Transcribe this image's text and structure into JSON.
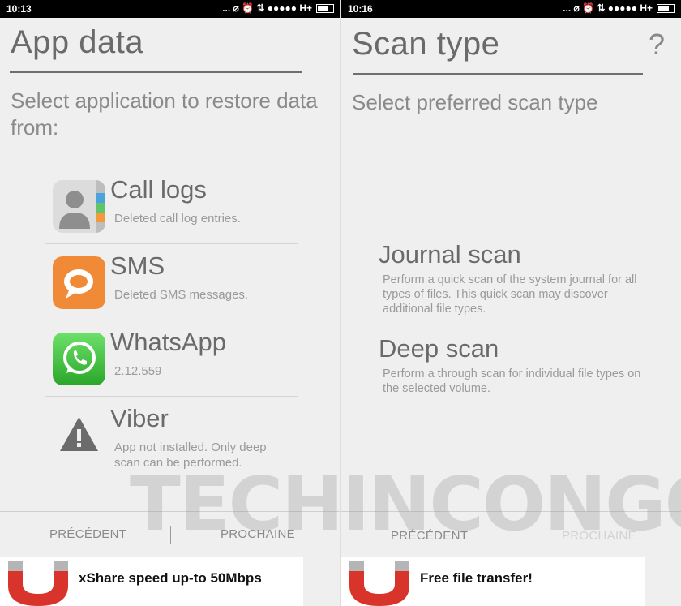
{
  "left": {
    "status_time": "10:13",
    "status_icons": "... ⌀ ⏰ ⇅ ●●●●● H+",
    "title": "App data",
    "subtitle": "Select application to restore data from:",
    "apps": [
      {
        "name": "Call logs",
        "desc": "Deleted call log entries.",
        "icon": "contacts-icon"
      },
      {
        "name": "SMS",
        "desc": "Deleted SMS messages.",
        "icon": "sms-icon"
      },
      {
        "name": "WhatsApp",
        "desc": "2.12.559",
        "icon": "whatsapp-icon"
      },
      {
        "name": "Viber",
        "desc": "App not installed. Only deep scan can be performed.",
        "icon": "warning-icon"
      }
    ],
    "prev_label": "PRÉCÉDENT",
    "next_label": "PROCHAINE",
    "ad_text": "xShare speed up-to 50Mbps"
  },
  "right": {
    "status_time": "10:16",
    "status_icons": "... ⌀ ⏰ ⇅ ●●●●● H+",
    "title": "Scan type",
    "help": "?",
    "subtitle": "Select preferred scan type",
    "scans": [
      {
        "name": "Journal scan",
        "desc": "Perform a quick scan of the system journal for all types of files. This quick scan may discover additional file types."
      },
      {
        "name": "Deep scan",
        "desc": "Perform a through scan for individual file types on the selected volume."
      }
    ],
    "prev_label": "PRÉCÉDENT",
    "next_label": "PROCHAINE",
    "ad_text": "Free file transfer!"
  },
  "watermark": "TECHINCONGO.NET",
  "colors": {
    "sms": "#f08a36",
    "whatsapp": "#3fbf3c",
    "warning": "#6b6b6b",
    "magnet_red": "#d9342b"
  }
}
